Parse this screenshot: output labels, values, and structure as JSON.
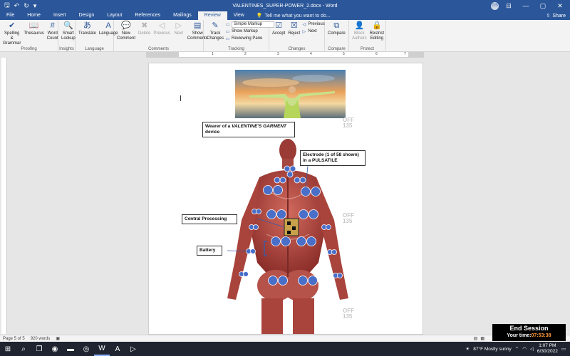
{
  "window": {
    "title": "VALENTINES_SUPER-POWER_2.docx - Word",
    "user_initials": "GS",
    "minimize": "—",
    "maximize": "▢",
    "close": "✕"
  },
  "menu": {
    "tabs": [
      "File",
      "Home",
      "Insert",
      "Design",
      "Layout",
      "References",
      "Mailings",
      "Review",
      "View"
    ],
    "active_tab": "Review",
    "tellme": "Tell me what you want to do...",
    "share": "Share"
  },
  "ribbon": {
    "proofing": {
      "label": "Proofing",
      "spelling": "Spelling & Grammar",
      "thesaurus": "Thesaurus",
      "wordcount": "Word Count"
    },
    "insights": {
      "label": "Insights",
      "smartlookup": "Smart Lookup"
    },
    "language": {
      "label": "Language",
      "translate": "Translate",
      "language": "Language"
    },
    "comments": {
      "label": "Comments",
      "new": "New Comment",
      "delete": "Delete",
      "previous": "Previous",
      "next": "Next",
      "show": "Show Comments"
    },
    "tracking": {
      "label": "Tracking",
      "track": "Track Changes",
      "simple_markup": "Simple Markup",
      "show_markup": "Show Markup",
      "reviewing_pane": "Reviewing Pane"
    },
    "changes": {
      "label": "Changes",
      "accept": "Accept",
      "reject": "Reject",
      "previous": "Previous",
      "next": "Next"
    },
    "compare": {
      "label": "Compare",
      "compare": "Compare"
    },
    "protect": {
      "label": "Protect",
      "block": "Block Authors",
      "restrict": "Restrict Editing"
    }
  },
  "ruler": {
    "numbers": [
      "1",
      "2",
      "3",
      "4",
      "5",
      "6",
      "7"
    ]
  },
  "document": {
    "callouts": {
      "wearer_pre": "Wearer of a ",
      "wearer_em": "VALENTINE'S GARMENT",
      "wearer_post": "device",
      "electrode": "Electrode (1 of 58 shown) in a PULSATILE",
      "central": "Central Processing",
      "battery": "Battery"
    },
    "watermarks": [
      "OFF",
      "135",
      "OFF",
      "135",
      "OFF",
      "135"
    ]
  },
  "status": {
    "page": "Page 5 of 5",
    "words": "920 words"
  },
  "session": {
    "title": "End Session",
    "time_label": "Your time:",
    "time_value": "07:53:38"
  },
  "taskbar": {
    "weather": "87°F  Mostly sunny",
    "time": "1:07 PM",
    "date": "6/30/2022"
  },
  "colors": {
    "word_blue": "#2b579a",
    "hex_blue": "#4a6fc9",
    "muscle": "#b8453f"
  }
}
